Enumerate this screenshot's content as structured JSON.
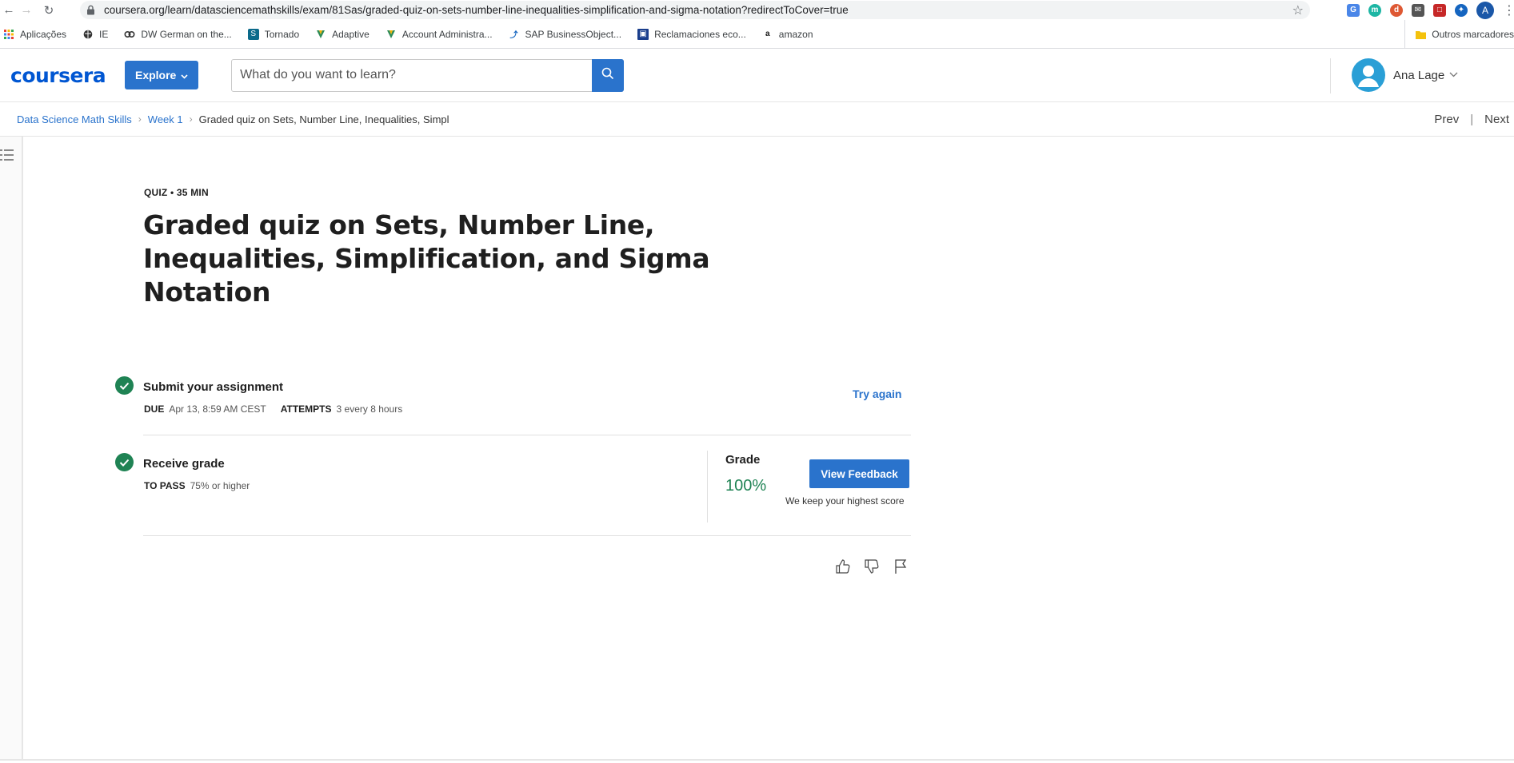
{
  "browser": {
    "url": "coursera.org/learn/datasciencemathskills/exam/81Sas/graded-quiz-on-sets-number-line-inequalities-simplification-and-sigma-notation?redirectToCover=true",
    "profile_initial": "A",
    "bookmarks": [
      {
        "label": "Aplicações",
        "icon": "apps-grid-icon"
      },
      {
        "label": "IE",
        "icon": "globe-icon"
      },
      {
        "label": "DW German on the...",
        "icon": "link-icon"
      },
      {
        "label": "Tornado",
        "icon": "sharepoint-icon"
      },
      {
        "label": "Adaptive",
        "icon": "adaptive-icon"
      },
      {
        "label": "Account Administra...",
        "icon": "adaptive-icon"
      },
      {
        "label": "SAP BusinessObject...",
        "icon": "sap-icon"
      },
      {
        "label": "Reclamaciones eco...",
        "icon": "document-icon"
      },
      {
        "label": "amazon",
        "icon": "amazon-icon"
      }
    ],
    "other_bookmarks": "Outros marcadores"
  },
  "header": {
    "logo": "coursera",
    "explore_label": "Explore",
    "search_placeholder": "What do you want to learn?",
    "user_name": "Ana Lage"
  },
  "breadcrumb": {
    "course": "Data Science Math Skills",
    "week": "Week 1",
    "current": "Graded quiz on Sets, Number Line, Inequalities, Simpl"
  },
  "pager": {
    "prev": "Prev",
    "next": "Next"
  },
  "quiz": {
    "meta": "QUIZ • 35 MIN",
    "title": "Graded quiz on Sets, Number Line, Inequalities, Simplification, and Sigma Notation",
    "submit": {
      "title": "Submit your assignment",
      "due_label": "DUE",
      "due_value": "Apr 13, 8:59 AM CEST",
      "attempts_label": "ATTEMPTS",
      "attempts_value": "3 every 8 hours",
      "try_again": "Try again"
    },
    "receive": {
      "title": "Receive grade",
      "pass_label": "TO PASS",
      "pass_value": "75% or higher"
    },
    "grade": {
      "label": "Grade",
      "value": "100%",
      "feedback_button": "View Feedback",
      "note": "We keep your highest score"
    }
  },
  "colors": {
    "brand": "#0056d2",
    "button": "#2a73cc",
    "success": "#1f8354"
  }
}
